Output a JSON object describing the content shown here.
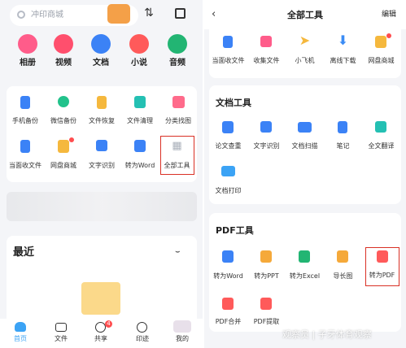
{
  "left": {
    "search_placeholder": "冲印商城",
    "top_icons": [
      {
        "label": "相册",
        "color": "#ff5c8a"
      },
      {
        "label": "视频",
        "color": "#ff4f6d"
      },
      {
        "label": "文档",
        "color": "#3b82f6"
      },
      {
        "label": "小说",
        "color": "#ff5a5a"
      },
      {
        "label": "音频",
        "color": "#22b573"
      }
    ],
    "tools_row1": [
      "手机备份",
      "微信备份",
      "文件恢复",
      "文件清理",
      "分类找图"
    ],
    "tools_row2": [
      "当面收文件",
      "网盘商城",
      "文字识别",
      "转为Word",
      "全部工具"
    ],
    "recent_title": "最近",
    "nav": [
      "首页",
      "文件",
      "共享",
      "印迹",
      "我的"
    ],
    "share_badge": "4"
  },
  "right": {
    "title": "全部工具",
    "edit": "编辑",
    "top_row": [
      "当面收文件",
      "收集文件",
      "小飞机",
      "离线下载",
      "网盘商城"
    ],
    "doc_section": "文档工具",
    "doc_row1": [
      "论文查重",
      "文字识别",
      "文档扫描",
      "笔记",
      "全文翻译"
    ],
    "doc_row2": [
      "文档打印"
    ],
    "pdf_section": "PDF工具",
    "pdf_row1": [
      "转为Word",
      "转为PPT",
      "转为Excel",
      "导长图",
      "转为PDF"
    ],
    "pdf_row2": [
      "PDF合并",
      "PDF提取"
    ],
    "watermark": "观察员 | 子牙体育观察"
  }
}
